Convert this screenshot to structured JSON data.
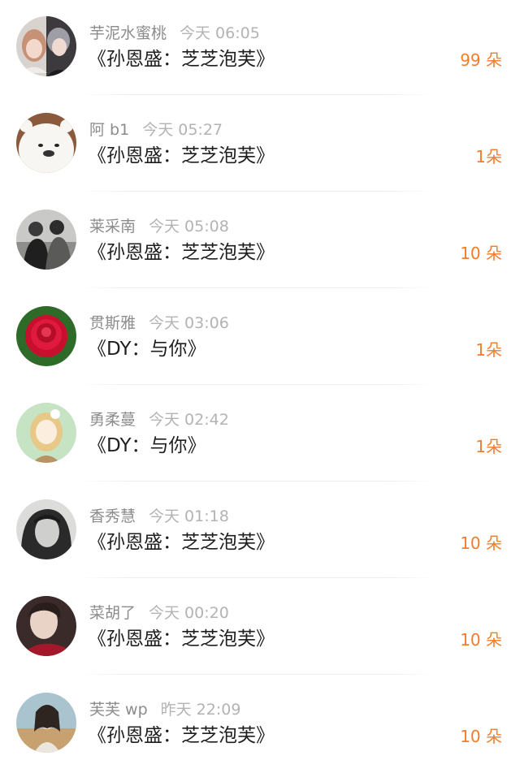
{
  "entries": [
    {
      "username": "芋泥水蜜桃",
      "time": "今天 06:05",
      "song": "《孙恩盛：芝芝泡芙》",
      "count": "99 朵",
      "avatar": "avatar-two-girls-photo"
    },
    {
      "username": "阿 b1",
      "time": "今天 05:27",
      "song": "《孙恩盛：芝芝泡芙》",
      "count": "1朵",
      "avatar": "avatar-white-bear-cartoon"
    },
    {
      "username": "莱采南",
      "time": "今天 05:08",
      "song": "《孙恩盛：芝芝泡芙》",
      "count": "10 朵",
      "avatar": "avatar-two-people-photo"
    },
    {
      "username": "贯斯雅",
      "time": "今天 03:06",
      "song": "《DY：与你》",
      "count": "1朵",
      "avatar": "avatar-red-rose"
    },
    {
      "username": "勇柔蔓",
      "time": "今天 02:42",
      "song": "《DY：与你》",
      "count": "1朵",
      "avatar": "avatar-anime-girl"
    },
    {
      "username": "香秀慧",
      "time": "今天 01:18",
      "song": "《孙恩盛：芝芝泡芙》",
      "count": "10 朵",
      "avatar": "avatar-hooded-person-bw"
    },
    {
      "username": "菜胡了",
      "time": "今天 00:20",
      "song": "《孙恩盛：芝芝泡芙》",
      "count": "10 朵",
      "avatar": "avatar-young-man-photo"
    },
    {
      "username": "芙芙 wp",
      "time": "昨天 22:09",
      "song": "《孙恩盛：芝芝泡芙》",
      "count": "10 朵",
      "avatar": "avatar-girl-outdoor-photo"
    }
  ],
  "colors": {
    "count": "#f47c2a",
    "username": "#8c8c8c",
    "time": "#b3b3b3",
    "song": "#1f1f1f"
  }
}
